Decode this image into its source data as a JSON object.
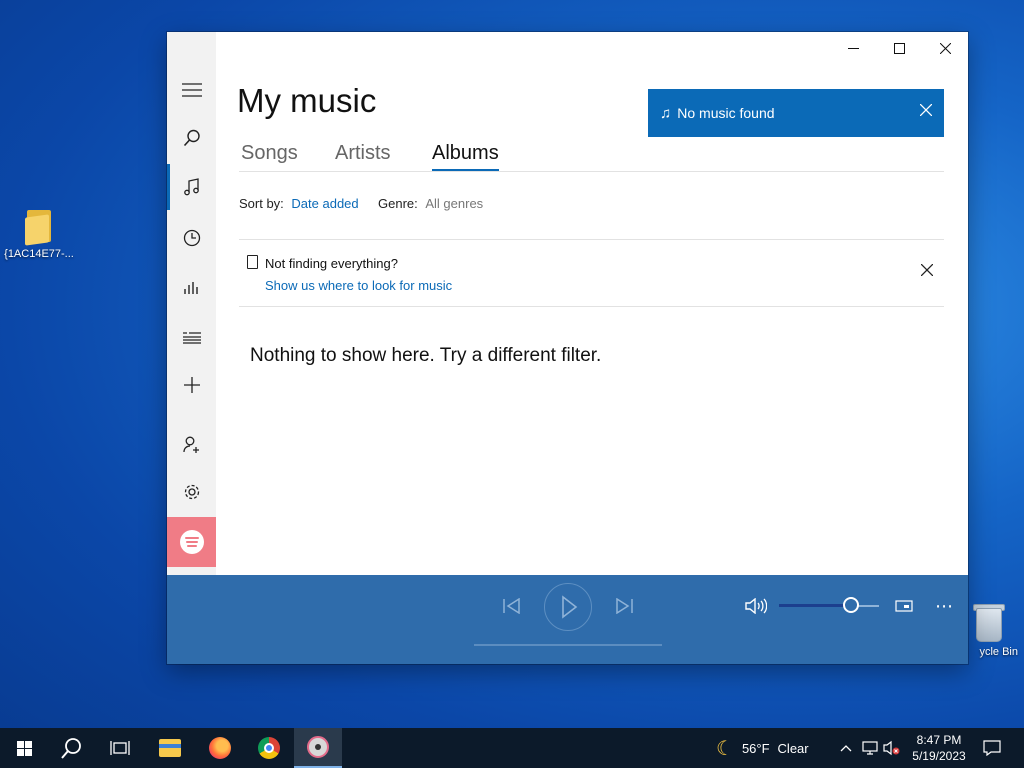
{
  "desktop": {
    "icons": [
      {
        "label": "{1AC14E77-..."
      },
      {
        "label": "ycle Bin"
      }
    ]
  },
  "window": {
    "title": "My music",
    "tabs": [
      {
        "label": "Songs"
      },
      {
        "label": "Artists"
      },
      {
        "label": "Albums",
        "active": true
      }
    ],
    "sort_label": "Sort by:",
    "sort_value": "Date added",
    "genre_label": "Genre:",
    "genre_value": "All genres",
    "banner_text": "No music found",
    "notice_title": "Not finding everything?",
    "notice_link": "Show us where to look for music",
    "empty_message": "Nothing to show here. Try a different filter.",
    "sidebar": [
      {
        "icon": "hamburger-menu-icon"
      },
      {
        "icon": "search-icon"
      },
      {
        "icon": "music-note-icon",
        "active": true
      },
      {
        "icon": "recent-clock-icon"
      },
      {
        "icon": "now-playing-bars-icon"
      },
      {
        "icon": "playlists-icon"
      },
      {
        "icon": "plus-icon"
      },
      {
        "icon": "user-add-icon"
      },
      {
        "icon": "gear-icon"
      },
      {
        "icon": "spotify-icon"
      }
    ]
  },
  "player": {
    "volume_level": 0.72
  },
  "taskbar": {
    "weather_temp": "56°F",
    "weather_cond": "Clear",
    "time": "8:47 PM",
    "date": "5/19/2023"
  },
  "colors": {
    "accent": "#0b6ab7",
    "player_bar": "#2f6cab",
    "spotify_tile": "#f07c86",
    "taskbar": "#0c1a2a"
  }
}
